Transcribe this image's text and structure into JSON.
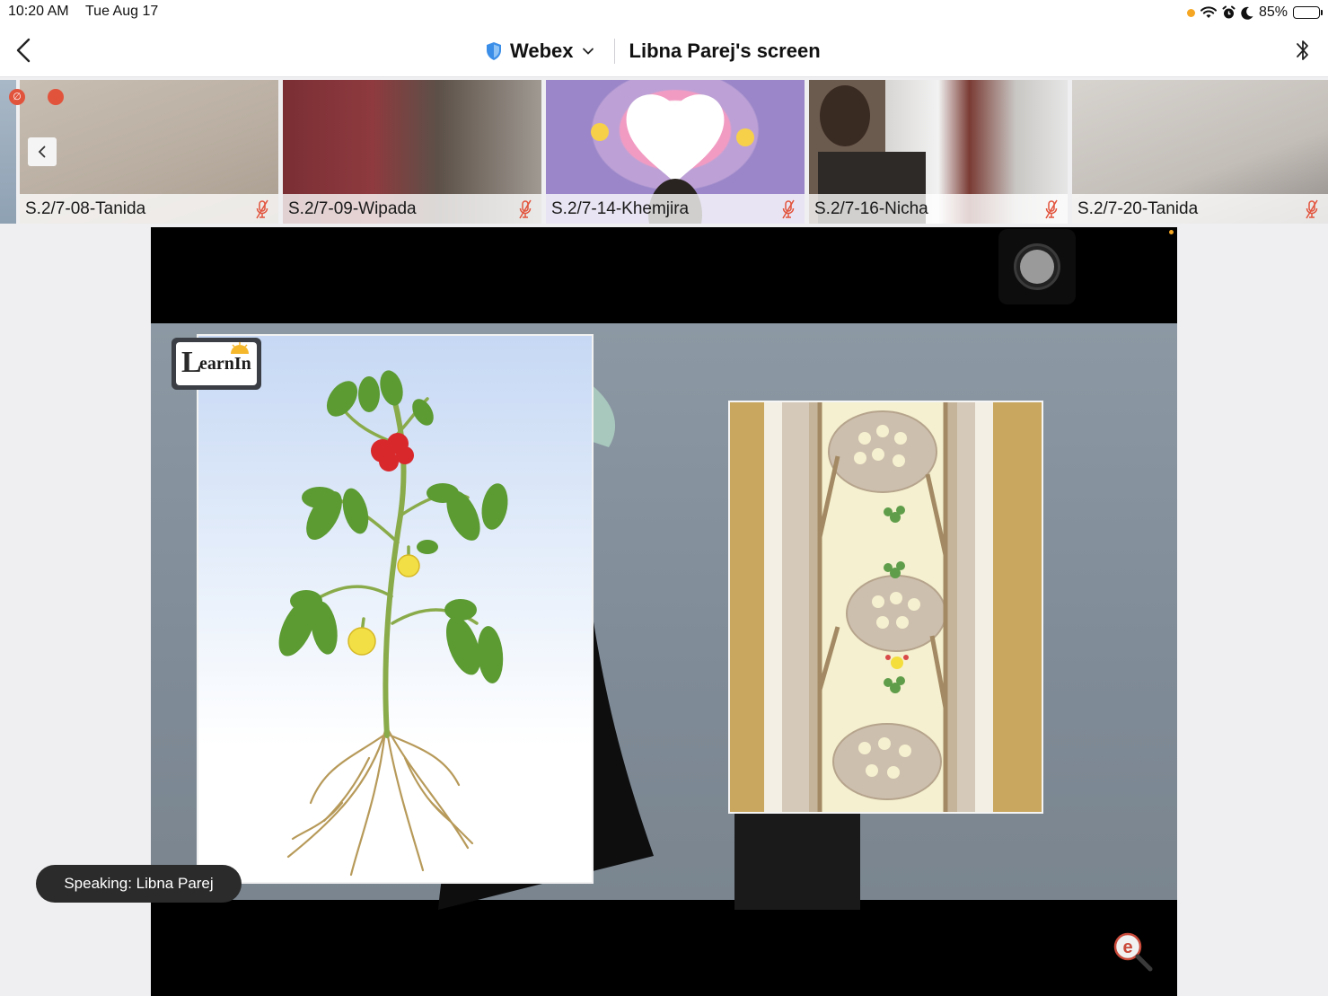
{
  "status_bar": {
    "time": "10:20 AM",
    "date": "Tue Aug 17",
    "battery": "85%",
    "battery_level": 0.85
  },
  "nav": {
    "app_name": "Webex",
    "screen_title": "Libna Parej's screen",
    "icons": [
      "chevron-left-icon",
      "shield-icon",
      "chevron-down-icon",
      "bluetooth-icon"
    ]
  },
  "participants": [
    {
      "name": "S.2/7-08-Tanida",
      "muted": true
    },
    {
      "name": "S.2/7-09-Wipada",
      "muted": true
    },
    {
      "name": "S.2/7-14-Khemjira",
      "muted": true
    },
    {
      "name": "S.2/7-16-Nicha",
      "muted": true
    },
    {
      "name": "S.2/7-20-Tanida",
      "muted": true
    }
  ],
  "share": {
    "logo_text": "earnIn",
    "logo_initial": "L",
    "speaking": "Speaking: Libna Parej"
  },
  "colors": {
    "accent_orange": "#f5a623",
    "mute_red": "#e2533c",
    "webex_shield": "#3b8ee8"
  }
}
